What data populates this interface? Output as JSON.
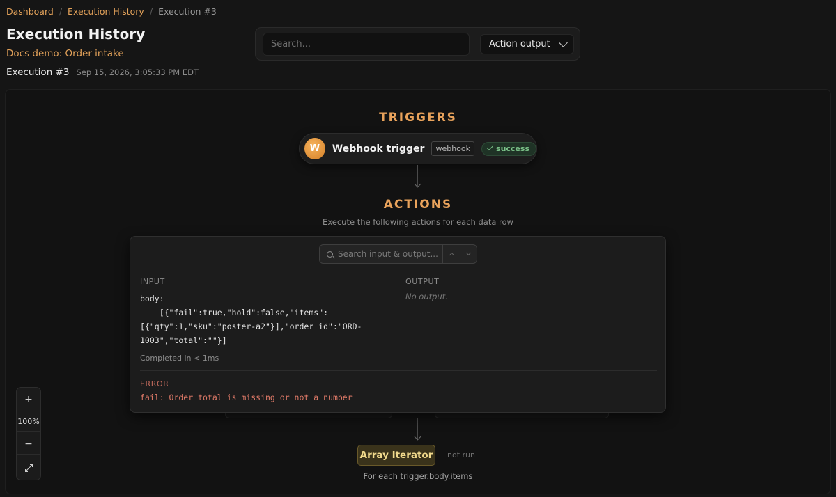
{
  "breadcrumb": {
    "items": [
      "Dashboard",
      "Execution History",
      "Execution #3"
    ],
    "separator": "/"
  },
  "header": {
    "title": "Execution History",
    "workflow_name": "Docs demo: Order intake",
    "execution_id": "Execution #3",
    "execution_time": "Sep 15, 2026, 3:05:33 PM EDT"
  },
  "toolbar": {
    "search_placeholder": "Search...",
    "view_select": "Action output"
  },
  "triggers": {
    "title": "TRIGGERS",
    "node": {
      "avatar": "W",
      "name": "Webhook trigger",
      "kind": "webhook",
      "status": "success"
    }
  },
  "actions": {
    "title": "ACTIONS",
    "subtitle": "Execute the following actions for each data row"
  },
  "panel": {
    "search_placeholder": "Search input & output...",
    "input_label": "INPUT",
    "input_text": "body:\n    [{\"fail\":true,\"hold\":false,\"items\":\n[{\"qty\":1,\"sku\":\"poster-a2\"}],\"order_id\":\"ORD-\n1003\",\"total\":\"\"}]",
    "output_label": "OUTPUT",
    "output_text": "No output.",
    "completed": "Completed in < 1ms",
    "error_label": "ERROR",
    "error_text": "fail: Order total is missing or not a number"
  },
  "iterator": {
    "label": "Array Iterator",
    "status": "not run",
    "subtitle": "For each trigger.body.items"
  },
  "zoom": {
    "in": "+",
    "level": "100%",
    "out": "−"
  },
  "colors": {
    "accent": "#e3a25a",
    "success": "#7cc48a",
    "error": "#e07a68"
  }
}
